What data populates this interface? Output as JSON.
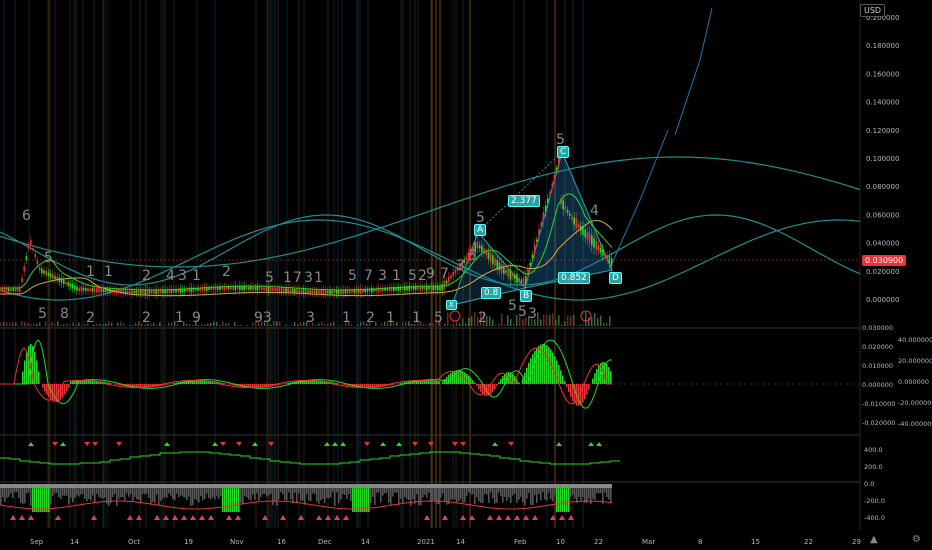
{
  "price_axis": {
    "currency": "USD",
    "ticks": [
      "0.200000",
      "0.180000",
      "0.160000",
      "0.140000",
      "0.120000",
      "0.100000",
      "0.080000",
      "0.060000",
      "0.040000",
      "0.020000",
      "0.000000"
    ],
    "last_price": "0.030900"
  },
  "oscillator_axis": {
    "ticks": [
      "0.030000",
      "0.020000",
      "0.010000",
      "0.000000",
      "-0.010000",
      "-0.020000"
    ],
    "right_ticks": [
      "40.000000",
      "20.000000",
      "0.000000",
      "-20.000000",
      "-40.000000"
    ]
  },
  "lower_axis": {
    "ticks": [
      "400.0",
      "200.0",
      "0.0",
      "-200.0",
      "-400.0"
    ]
  },
  "time_axis": {
    "ticks": [
      "Sep",
      "14",
      "Oct",
      "19",
      "Nov",
      "16",
      "Dec",
      "14",
      "2021",
      "14",
      "Feb",
      "10",
      "22",
      "Mar",
      "8",
      "15",
      "22",
      "29"
    ]
  },
  "pattern_labels": {
    "x": "X",
    "a": "A",
    "b": "B",
    "c": "C",
    "d": "D",
    "ratio_ab": "0.8",
    "ratio_bc": "2.377",
    "ratio_cd": "0.852"
  },
  "wave_numbers": [
    "6",
    "5",
    "1",
    "1",
    "2",
    "4",
    "3",
    "1",
    "2",
    "5",
    "1",
    "7",
    "3",
    "1",
    "5",
    "7",
    "3",
    "1",
    "5",
    "2",
    "9",
    "7",
    "3",
    "5",
    "5",
    "5",
    "4",
    "5",
    "8",
    "2",
    "2",
    "1",
    "9",
    "93",
    "3",
    "1",
    "2",
    "1",
    "1",
    "5",
    "5",
    "5",
    "3",
    "2"
  ],
  "colors": {
    "bull": "#26d926",
    "bear": "#e8333a",
    "accent": "#2aa3a3",
    "grid": "#1a1a1a"
  },
  "icons": [
    "tradingview-logo-icon",
    "settings-gear-icon"
  ]
}
